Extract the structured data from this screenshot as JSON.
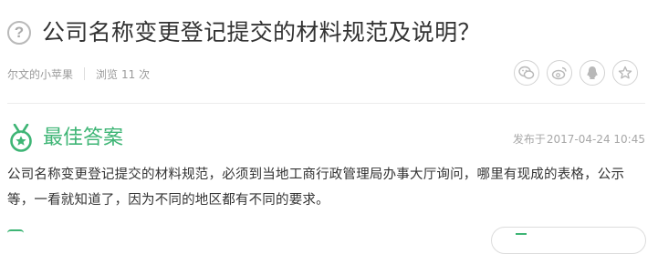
{
  "question": {
    "title": "公司名称变更登记提交的材料规范及说明？",
    "icon": "question-circle-icon",
    "author": "尔文的小苹果",
    "views_label": "浏览",
    "views_count": "11 次"
  },
  "share": {
    "icons": [
      "wechat-icon",
      "weibo-icon",
      "qq-icon",
      "favorite-icon"
    ]
  },
  "best_answer": {
    "title": "最佳答案",
    "icon": "medal-icon",
    "time_label": "发布于",
    "time": "2017-04-24 10:45",
    "text": "公司名称变更登记提交的材料规范，必须到当地工商行政管理局办事大厅询问，哪里有现成的表格，公示等，一看就知道了，因为不同的地区都有不同的要求。"
  },
  "colors": {
    "accent": "#3eb575",
    "text": "#333333",
    "muted": "#9a9a9a"
  }
}
